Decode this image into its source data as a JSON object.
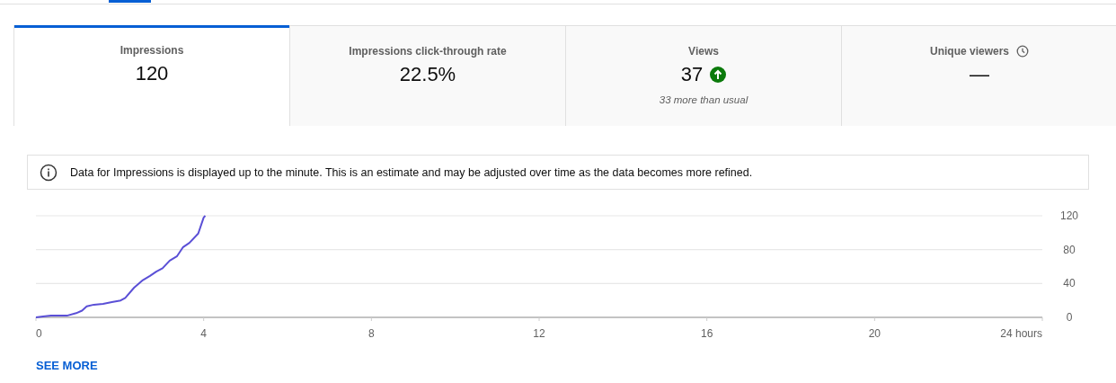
{
  "cards": [
    {
      "label": "Impressions",
      "value": "120",
      "selected": true,
      "kind": "plain"
    },
    {
      "label": "Impressions click-through rate",
      "value": "22.5%",
      "selected": false,
      "kind": "plain"
    },
    {
      "label": "Views",
      "value": "37",
      "selected": false,
      "kind": "trend_up",
      "note": "33 more than usual"
    },
    {
      "label": "Unique viewers",
      "value": "—",
      "selected": false,
      "kind": "pending"
    }
  ],
  "notice": "Data for Impressions is displayed up to the minute. This is an estimate and may be adjusted over time as the data becomes more refined.",
  "chart_data": {
    "type": "line",
    "xlim": [
      0,
      24
    ],
    "ylim": [
      0,
      120
    ],
    "xticks": [
      0,
      4,
      8,
      12,
      16,
      20,
      {
        "value": 24,
        "label": "24 hours"
      }
    ],
    "yticks": [
      0,
      40,
      80,
      120
    ],
    "x": [
      0,
      0.17,
      0.36,
      0.74,
      0.96,
      1.1,
      1.21,
      1.38,
      1.6,
      1.81,
      2.02,
      2.13,
      2.34,
      2.55,
      2.72,
      2.87,
      3.02,
      3.19,
      3.36,
      3.51,
      3.66,
      3.87,
      4.0,
      4.04
    ],
    "series": [
      {
        "color": "#5a4fd6",
        "values": [
          0,
          1,
          2,
          2,
          5,
          8,
          13,
          15,
          16,
          18,
          20,
          23,
          35,
          44,
          49,
          54,
          58,
          67,
          72,
          83,
          88,
          99,
          118,
          120
        ]
      }
    ]
  },
  "see_more": "SEE MORE"
}
